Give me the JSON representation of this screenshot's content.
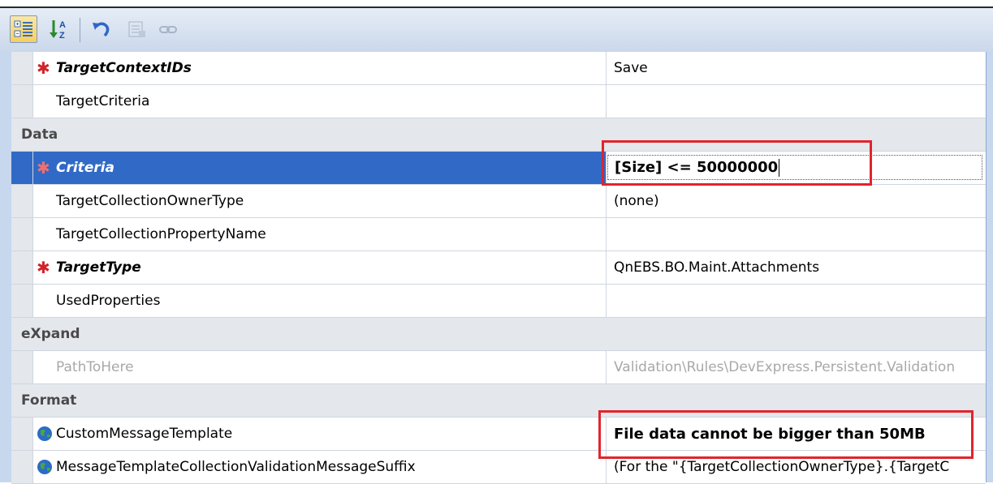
{
  "toolbar": {
    "buttons": [
      {
        "icon": "categorized-icon",
        "active": true
      },
      {
        "icon": "alphabetical-sort-icon",
        "active": false
      },
      {
        "icon": "reset-icon",
        "active": false
      },
      {
        "icon": "property-pages-icon",
        "active": false
      },
      {
        "icon": "link-icon",
        "active": false
      }
    ]
  },
  "rows": {
    "target_context_ids": {
      "name": "TargetContextIDs",
      "value": "Save"
    },
    "target_criteria": {
      "name": "TargetCriteria",
      "value": ""
    },
    "cat_data": "Data",
    "criteria": {
      "name": "Criteria",
      "value": "[Size] <= 50000000"
    },
    "target_collection_owner_type": {
      "name": "TargetCollectionOwnerType",
      "value": "(none)"
    },
    "target_collection_property_name": {
      "name": "TargetCollectionPropertyName",
      "value": ""
    },
    "target_type": {
      "name": "TargetType",
      "value": "QnEBS.BO.Maint.Attachments"
    },
    "used_properties": {
      "name": "UsedProperties",
      "value": ""
    },
    "cat_expand": "eXpand",
    "path_to_here": {
      "name": "PathToHere",
      "value": "Validation\\Rules\\DevExpress.Persistent.Validation"
    },
    "cat_format": "Format",
    "custom_message_template": {
      "name": "CustomMessageTemplate",
      "value": "File data cannot be bigger than 50MB"
    },
    "message_template_suffix": {
      "name": "MessageTemplateCollectionValidationMessageSuffix",
      "value": "(For the \"{TargetCollectionOwnerType}.{TargetC"
    }
  },
  "colors": {
    "selection": "#3169c6",
    "required_marker": "#d0242a",
    "highlight_box": "#e0252d",
    "category_bg": "#e4e7ec"
  }
}
